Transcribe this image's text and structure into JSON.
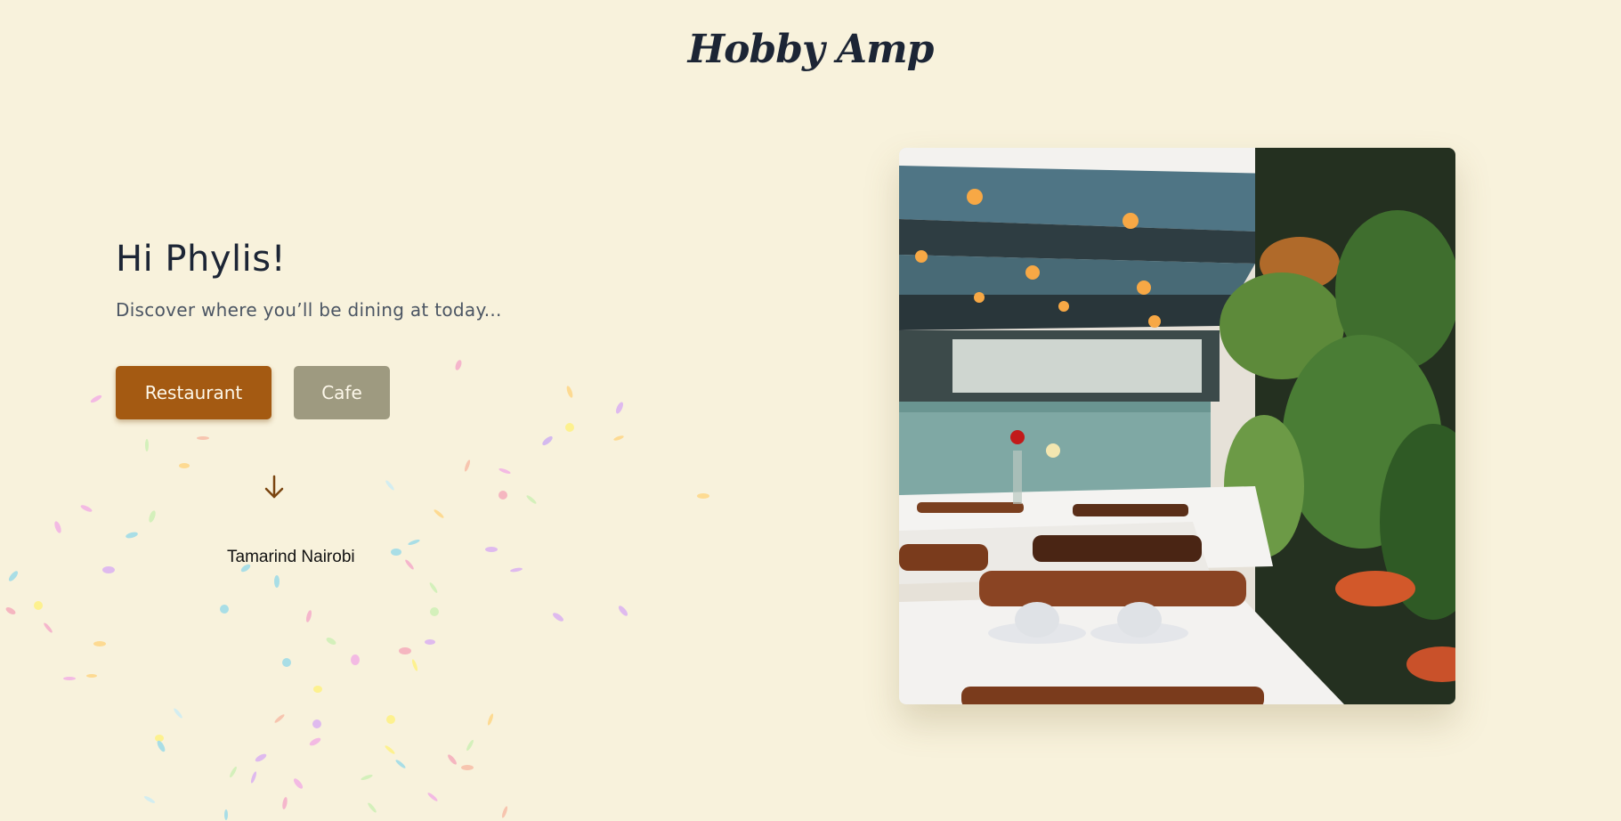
{
  "header": {
    "brand": "Hobby Amp"
  },
  "hero": {
    "greeting": "Hi Phylis!",
    "subtitle": "Discover where you’ll be dining at today...",
    "buttons": {
      "restaurant": "Restaurant",
      "cafe": "Cafe"
    },
    "result": "Tamarind Nairobi"
  },
  "colors": {
    "background": "#f8f2dc",
    "accent": "#a45a12",
    "secondary_button": "#9e9a80",
    "text_dark": "#1c2535"
  },
  "icons": {
    "arrow": "arrow-down-icon"
  }
}
